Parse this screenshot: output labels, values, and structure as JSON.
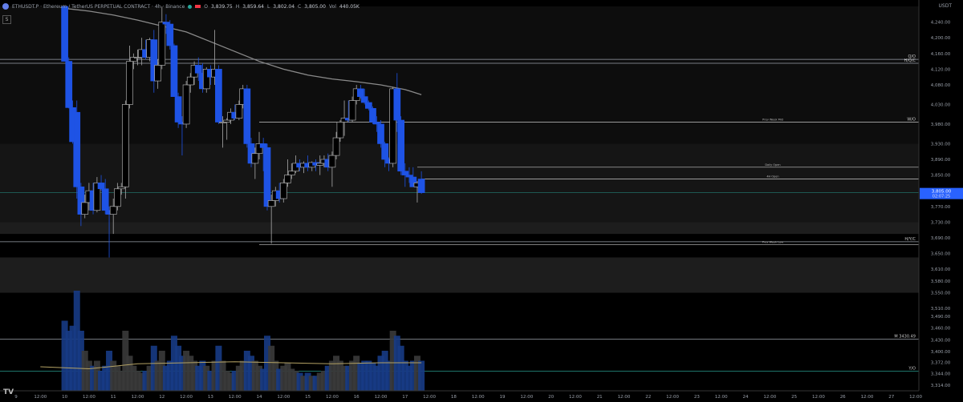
{
  "header": {
    "symbol": "ETHUSDT.P · Ethereum / TetherUS PERPETUAL CONTRACT · 4h · Binance",
    "open": "3,839.75",
    "high": "3,859.64",
    "low": "3,802.04",
    "close": "3,805.00",
    "volume": "440.05K",
    "currency": "USDT",
    "s_button": "S"
  },
  "price_badge": {
    "price": "3,805.00",
    "countdown": "02:07:25",
    "color": "#2962ff"
  },
  "colors": {
    "bull_body": "#000000",
    "bull_border": "#aaaaaa",
    "bear": "#1e53e5",
    "ma": "#8a8a8a",
    "vol_ma": "#b4a264"
  },
  "chart_data": {
    "type": "candlestick",
    "timeframe": "4h",
    "ylim": [
      3300,
      4280
    ],
    "y_ticks": [
      "4,240.00",
      "4,200.00",
      "4,160.00",
      "4,120.00",
      "4,080.00",
      "4,030.00",
      "3,980.00",
      "3,930.00",
      "3,890.00",
      "3,850.00",
      "3,810.00",
      "3,770.00",
      "3,730.00",
      "3,690.00",
      "3,650.00",
      "3,610.00",
      "3,580.00",
      "3,550.00",
      "3,510.00",
      "3,490.00",
      "3,460.00",
      "3,430.00",
      "3,400.00",
      "3,372.00",
      "3,344.00",
      "3,314.00"
    ],
    "x_ticks": [
      {
        "label": "9",
        "x": -1
      },
      {
        "label": "12:00",
        "x": 0
      },
      {
        "label": "10",
        "x": 1
      },
      {
        "label": "12:00",
        "x": 2
      },
      {
        "label": "11",
        "x": 3
      },
      {
        "label": "12:00",
        "x": 4
      },
      {
        "label": "12",
        "x": 5
      },
      {
        "label": "12:00",
        "x": 6
      },
      {
        "label": "13",
        "x": 7
      },
      {
        "label": "12:00",
        "x": 8
      },
      {
        "label": "14",
        "x": 9
      },
      {
        "label": "12:00",
        "x": 10
      },
      {
        "label": "15",
        "x": 11
      },
      {
        "label": "12:00",
        "x": 12
      },
      {
        "label": "16",
        "x": 13
      },
      {
        "label": "12:00",
        "x": 14
      },
      {
        "label": "17",
        "x": 15
      },
      {
        "label": "12:00",
        "x": 16
      },
      {
        "label": "18",
        "x": 17
      },
      {
        "label": "12:00",
        "x": 18
      },
      {
        "label": "19",
        "x": 19
      },
      {
        "label": "12:00",
        "x": 20
      },
      {
        "label": "20",
        "x": 21
      },
      {
        "label": "12:00",
        "x": 22
      },
      {
        "label": "21",
        "x": 23
      },
      {
        "label": "12:00",
        "x": 24
      },
      {
        "label": "22",
        "x": 25
      },
      {
        "label": "12:00",
        "x": 26
      },
      {
        "label": "23",
        "x": 27
      },
      {
        "label": "12:00",
        "x": 28
      },
      {
        "label": "24",
        "x": 29
      },
      {
        "label": "12:00",
        "x": 30
      },
      {
        "label": "25",
        "x": 31
      },
      {
        "label": "12:00",
        "x": 32
      },
      {
        "label": "26",
        "x": 33
      },
      {
        "label": "12:00",
        "x": 34
      },
      {
        "label": "27",
        "x": 35
      },
      {
        "label": "12:00",
        "x": 36
      }
    ],
    "candles": [
      {
        "t": 1.0,
        "o": 4280,
        "h": 4280,
        "l": 4140,
        "c": 4140,
        "v": 70
      },
      {
        "t": 1.17,
        "o": 4140,
        "h": 4150,
        "l": 4020,
        "c": 4022,
        "v": 60
      },
      {
        "t": 1.33,
        "o": 4022,
        "h": 4040,
        "l": 3930,
        "c": 3935,
        "v": 65
      },
      {
        "t": 1.5,
        "o": 4010,
        "h": 4040,
        "l": 3790,
        "c": 3820,
        "v": 100
      },
      {
        "t": 1.67,
        "o": 3820,
        "h": 3830,
        "l": 3720,
        "c": 3750,
        "v": 60
      },
      {
        "t": 1.83,
        "o": 3750,
        "h": 3800,
        "l": 3740,
        "c": 3780,
        "v": 40
      },
      {
        "t": 2.0,
        "o": 3780,
        "h": 3830,
        "l": 3760,
        "c": 3810,
        "v": 30
      },
      {
        "t": 2.17,
        "o": 3810,
        "h": 3830,
        "l": 3750,
        "c": 3760,
        "v": 25
      },
      {
        "t": 2.33,
        "o": 3760,
        "h": 3845,
        "l": 3755,
        "c": 3830,
        "v": 30
      },
      {
        "t": 2.5,
        "o": 3830,
        "h": 3850,
        "l": 3810,
        "c": 3815,
        "v": 20
      },
      {
        "t": 2.67,
        "o": 3815,
        "h": 3840,
        "l": 3750,
        "c": 3760,
        "v": 25
      },
      {
        "t": 2.83,
        "o": 3760,
        "h": 3770,
        "l": 3640,
        "c": 3750,
        "v": 40
      },
      {
        "t": 3.0,
        "o": 3750,
        "h": 3790,
        "l": 3700,
        "c": 3770,
        "v": 30
      },
      {
        "t": 3.17,
        "o": 3770,
        "h": 3830,
        "l": 3760,
        "c": 3815,
        "v": 25
      },
      {
        "t": 3.33,
        "o": 3815,
        "h": 3830,
        "l": 3800,
        "c": 3820,
        "v": 20
      },
      {
        "t": 3.5,
        "o": 3820,
        "h": 4040,
        "l": 3790,
        "c": 4030,
        "v": 60
      },
      {
        "t": 3.67,
        "o": 4030,
        "h": 4180,
        "l": 4020,
        "c": 4140,
        "v": 35
      },
      {
        "t": 3.83,
        "o": 4140,
        "h": 4160,
        "l": 4120,
        "c": 4150,
        "v": 25
      },
      {
        "t": 4.0,
        "o": 4150,
        "h": 4170,
        "l": 4130,
        "c": 4150,
        "v": 20
      },
      {
        "t": 4.17,
        "o": 4150,
        "h": 4200,
        "l": 4130,
        "c": 4170,
        "v": 18
      },
      {
        "t": 4.33,
        "o": 4170,
        "h": 4195,
        "l": 4145,
        "c": 4150,
        "v": 20
      },
      {
        "t": 4.5,
        "o": 4150,
        "h": 4200,
        "l": 4140,
        "c": 4195,
        "v": 25
      },
      {
        "t": 4.67,
        "o": 4195,
        "h": 4220,
        "l": 4060,
        "c": 4090,
        "v": 45
      },
      {
        "t": 4.83,
        "o": 4090,
        "h": 4145,
        "l": 4070,
        "c": 4130,
        "v": 30
      },
      {
        "t": 5.0,
        "o": 4130,
        "h": 4280,
        "l": 4120,
        "c": 4240,
        "v": 40
      },
      {
        "t": 5.17,
        "o": 4240,
        "h": 4260,
        "l": 4210,
        "c": 4235,
        "v": 25
      },
      {
        "t": 5.33,
        "o": 4235,
        "h": 4245,
        "l": 4170,
        "c": 4180,
        "v": 30
      },
      {
        "t": 5.5,
        "o": 4180,
        "h": 4185,
        "l": 4050,
        "c": 4050,
        "v": 55
      },
      {
        "t": 5.67,
        "o": 4050,
        "h": 4060,
        "l": 3970,
        "c": 3985,
        "v": 45
      },
      {
        "t": 5.83,
        "o": 3985,
        "h": 4000,
        "l": 3900,
        "c": 3980,
        "v": 35
      },
      {
        "t": 6.0,
        "o": 3980,
        "h": 4090,
        "l": 3970,
        "c": 4080,
        "v": 40
      },
      {
        "t": 6.17,
        "o": 4080,
        "h": 4110,
        "l": 4060,
        "c": 4100,
        "v": 35
      },
      {
        "t": 6.33,
        "o": 4100,
        "h": 4140,
        "l": 4080,
        "c": 4130,
        "v": 30
      },
      {
        "t": 6.5,
        "o": 4130,
        "h": 4150,
        "l": 4090,
        "c": 4110,
        "v": 25
      },
      {
        "t": 6.67,
        "o": 4110,
        "h": 4135,
        "l": 4060,
        "c": 4070,
        "v": 30
      },
      {
        "t": 6.83,
        "o": 4070,
        "h": 4125,
        "l": 4060,
        "c": 4120,
        "v": 25
      },
      {
        "t": 7.0,
        "o": 4120,
        "h": 4130,
        "l": 4080,
        "c": 4100,
        "v": 20
      },
      {
        "t": 7.17,
        "o": 4100,
        "h": 4220,
        "l": 4080,
        "c": 4120,
        "v": 30
      },
      {
        "t": 7.33,
        "o": 4120,
        "h": 4130,
        "l": 3980,
        "c": 3985,
        "v": 45
      },
      {
        "t": 7.5,
        "o": 3985,
        "h": 4000,
        "l": 3920,
        "c": 3985,
        "v": 30
      },
      {
        "t": 7.67,
        "o": 3985,
        "h": 3995,
        "l": 3940,
        "c": 3990,
        "v": 20
      },
      {
        "t": 7.83,
        "o": 3990,
        "h": 4020,
        "l": 3980,
        "c": 4010,
        "v": 18
      },
      {
        "t": 8.0,
        "o": 4010,
        "h": 4030,
        "l": 3990,
        "c": 3995,
        "v": 20
      },
      {
        "t": 8.17,
        "o": 3995,
        "h": 4040,
        "l": 3990,
        "c": 4030,
        "v": 25
      },
      {
        "t": 8.33,
        "o": 4030,
        "h": 4080,
        "l": 4020,
        "c": 4070,
        "v": 30
      },
      {
        "t": 8.5,
        "o": 4070,
        "h": 4080,
        "l": 3920,
        "c": 3930,
        "v": 40
      },
      {
        "t": 8.67,
        "o": 3930,
        "h": 3945,
        "l": 3870,
        "c": 3880,
        "v": 35
      },
      {
        "t": 8.83,
        "o": 3880,
        "h": 3920,
        "l": 3840,
        "c": 3905,
        "v": 30
      },
      {
        "t": 9.0,
        "o": 3905,
        "h": 3960,
        "l": 3890,
        "c": 3930,
        "v": 25
      },
      {
        "t": 9.17,
        "o": 3930,
        "h": 3945,
        "l": 3860,
        "c": 3920,
        "v": 22
      },
      {
        "t": 9.33,
        "o": 3920,
        "h": 3930,
        "l": 3760,
        "c": 3770,
        "v": 55
      },
      {
        "t": 9.5,
        "o": 3770,
        "h": 3800,
        "l": 3675,
        "c": 3785,
        "v": 45
      },
      {
        "t": 9.67,
        "o": 3785,
        "h": 3820,
        "l": 3770,
        "c": 3810,
        "v": 30
      },
      {
        "t": 9.83,
        "o": 3810,
        "h": 3830,
        "l": 3780,
        "c": 3790,
        "v": 22
      },
      {
        "t": 10.0,
        "o": 3790,
        "h": 3840,
        "l": 3780,
        "c": 3830,
        "v": 25
      },
      {
        "t": 10.17,
        "o": 3830,
        "h": 3890,
        "l": 3820,
        "c": 3850,
        "v": 28
      },
      {
        "t": 10.33,
        "o": 3850,
        "h": 3880,
        "l": 3840,
        "c": 3860,
        "v": 22
      },
      {
        "t": 10.5,
        "o": 3860,
        "h": 3900,
        "l": 3855,
        "c": 3880,
        "v": 20
      },
      {
        "t": 10.67,
        "o": 3880,
        "h": 3890,
        "l": 3860,
        "c": 3870,
        "v": 18
      },
      {
        "t": 10.83,
        "o": 3870,
        "h": 3885,
        "l": 3855,
        "c": 3880,
        "v": 15
      },
      {
        "t": 11.0,
        "o": 3880,
        "h": 3900,
        "l": 3860,
        "c": 3870,
        "v": 18
      },
      {
        "t": 11.17,
        "o": 3870,
        "h": 3885,
        "l": 3860,
        "c": 3882,
        "v": 15
      },
      {
        "t": 11.33,
        "o": 3882,
        "h": 3890,
        "l": 3860,
        "c": 3875,
        "v": 15
      },
      {
        "t": 11.5,
        "o": 3875,
        "h": 3900,
        "l": 3850,
        "c": 3880,
        "v": 18
      },
      {
        "t": 11.67,
        "o": 3880,
        "h": 3900,
        "l": 3870,
        "c": 3890,
        "v": 20
      },
      {
        "t": 11.83,
        "o": 3890,
        "h": 3905,
        "l": 3860,
        "c": 3870,
        "v": 25
      },
      {
        "t": 12.0,
        "o": 3870,
        "h": 3910,
        "l": 3820,
        "c": 3900,
        "v": 30
      },
      {
        "t": 12.17,
        "o": 3900,
        "h": 3960,
        "l": 3890,
        "c": 3945,
        "v": 35
      },
      {
        "t": 12.33,
        "o": 3945,
        "h": 3990,
        "l": 3935,
        "c": 3985,
        "v": 30
      },
      {
        "t": 12.5,
        "o": 3985,
        "h": 4040,
        "l": 3950,
        "c": 3995,
        "v": 25
      },
      {
        "t": 12.67,
        "o": 3995,
        "h": 4040,
        "l": 3985,
        "c": 3990,
        "v": 25
      },
      {
        "t": 12.83,
        "o": 3990,
        "h": 4050,
        "l": 3985,
        "c": 4040,
        "v": 30
      },
      {
        "t": 13.0,
        "o": 4040,
        "h": 4080,
        "l": 4030,
        "c": 4070,
        "v": 35
      },
      {
        "t": 13.17,
        "o": 4070,
        "h": 4080,
        "l": 4045,
        "c": 4050,
        "v": 28
      },
      {
        "t": 13.33,
        "o": 4050,
        "h": 4070,
        "l": 4030,
        "c": 4035,
        "v": 30
      },
      {
        "t": 13.5,
        "o": 4035,
        "h": 4040,
        "l": 4015,
        "c": 4020,
        "v": 30
      },
      {
        "t": 13.67,
        "o": 4020,
        "h": 4025,
        "l": 3980,
        "c": 3985,
        "v": 28
      },
      {
        "t": 13.83,
        "o": 3985,
        "h": 4000,
        "l": 3960,
        "c": 3980,
        "v": 25
      },
      {
        "t": 14.0,
        "o": 3980,
        "h": 3990,
        "l": 3920,
        "c": 3930,
        "v": 35
      },
      {
        "t": 14.17,
        "o": 3930,
        "h": 3935,
        "l": 3870,
        "c": 3890,
        "v": 40
      },
      {
        "t": 14.33,
        "o": 3890,
        "h": 3895,
        "l": 3860,
        "c": 3880,
        "v": 30
      },
      {
        "t": 14.5,
        "o": 3880,
        "h": 4075,
        "l": 3870,
        "c": 4070,
        "v": 60
      },
      {
        "t": 14.67,
        "o": 4070,
        "h": 4110,
        "l": 3960,
        "c": 3990,
        "v": 55
      },
      {
        "t": 14.83,
        "o": 3990,
        "h": 4000,
        "l": 3850,
        "c": 3860,
        "v": 45
      },
      {
        "t": 15.0,
        "o": 3860,
        "h": 3880,
        "l": 3820,
        "c": 3850,
        "v": 30
      },
      {
        "t": 15.17,
        "o": 3850,
        "h": 3870,
        "l": 3830,
        "c": 3845,
        "v": 25
      },
      {
        "t": 15.33,
        "o": 3845,
        "h": 3870,
        "l": 3820,
        "c": 3820,
        "v": 30
      },
      {
        "t": 15.5,
        "o": 3820,
        "h": 3835,
        "l": 3780,
        "c": 3830,
        "v": 35
      },
      {
        "t": 15.67,
        "o": 3839.75,
        "h": 3859.64,
        "l": 3802.04,
        "c": 3805.0,
        "v": 30
      }
    ],
    "ma200": [
      [
        1.0,
        4275
      ],
      [
        2.0,
        4268
      ],
      [
        3.0,
        4258
      ],
      [
        4.0,
        4245
      ],
      [
        5.0,
        4230
      ],
      [
        6.0,
        4215
      ],
      [
        7.0,
        4190
      ],
      [
        8.0,
        4165
      ],
      [
        9.0,
        4140
      ],
      [
        10.0,
        4120
      ],
      [
        11.0,
        4105
      ],
      [
        12.0,
        4095
      ],
      [
        13.0,
        4088
      ],
      [
        14.0,
        4080
      ],
      [
        15.0,
        4068
      ],
      [
        15.67,
        4055
      ]
    ],
    "vol_ma": [
      [
        0,
        24
      ],
      [
        2,
        22
      ],
      [
        4,
        27
      ],
      [
        6,
        28
      ],
      [
        8,
        29
      ],
      [
        10,
        28
      ],
      [
        12,
        27
      ],
      [
        14,
        28
      ],
      [
        15.67,
        28
      ]
    ],
    "levels": [
      {
        "name": "Q/O",
        "price": 4145,
        "label": "Q/O",
        "color": "#9aa0aa"
      },
      {
        "name": "H/Q/C",
        "price": 4135,
        "label": "H/Q/C",
        "color": "#9aa0aa"
      },
      {
        "name": "W/O",
        "price": 3985,
        "label": "W/O",
        "start": 9.0,
        "note": "Prev Week Mid",
        "color": "#c8c8c8"
      },
      {
        "name": "Daily Open",
        "price": 3870,
        "start": 15.5,
        "note": "Daily Open",
        "color": "#c8c8c8"
      },
      {
        "name": "4H Open",
        "price": 3839.75,
        "start": 15.67,
        "note": "4H Open",
        "color": "#c8c8c8"
      },
      {
        "name": "H/Y/C",
        "price": 3680,
        "label": "H/Y/C",
        "color": "#9aa0aa"
      },
      {
        "name": "Prev Week Low",
        "price": 3673,
        "start": 9.0,
        "note": "Prev Week Low",
        "color": "#c8c8c8"
      },
      {
        "name": "M",
        "price": 3432,
        "label": "M 3430.49",
        "color": "#9aa0aa"
      },
      {
        "name": "Y/O",
        "price": 3350,
        "label": "Y/O",
        "color": "#2a9d8f"
      }
    ],
    "zones": [
      {
        "from": 3930,
        "to": 4280,
        "shade": "#0d0d0d"
      },
      {
        "from": 3730,
        "to": 3930,
        "shade": "#151515"
      },
      {
        "from": 3700,
        "to": 3730,
        "shade": "#1d1d1d"
      },
      {
        "from": 3550,
        "to": 3640,
        "shade": "#1d1d1d"
      }
    ],
    "price_line": 3805.0
  }
}
